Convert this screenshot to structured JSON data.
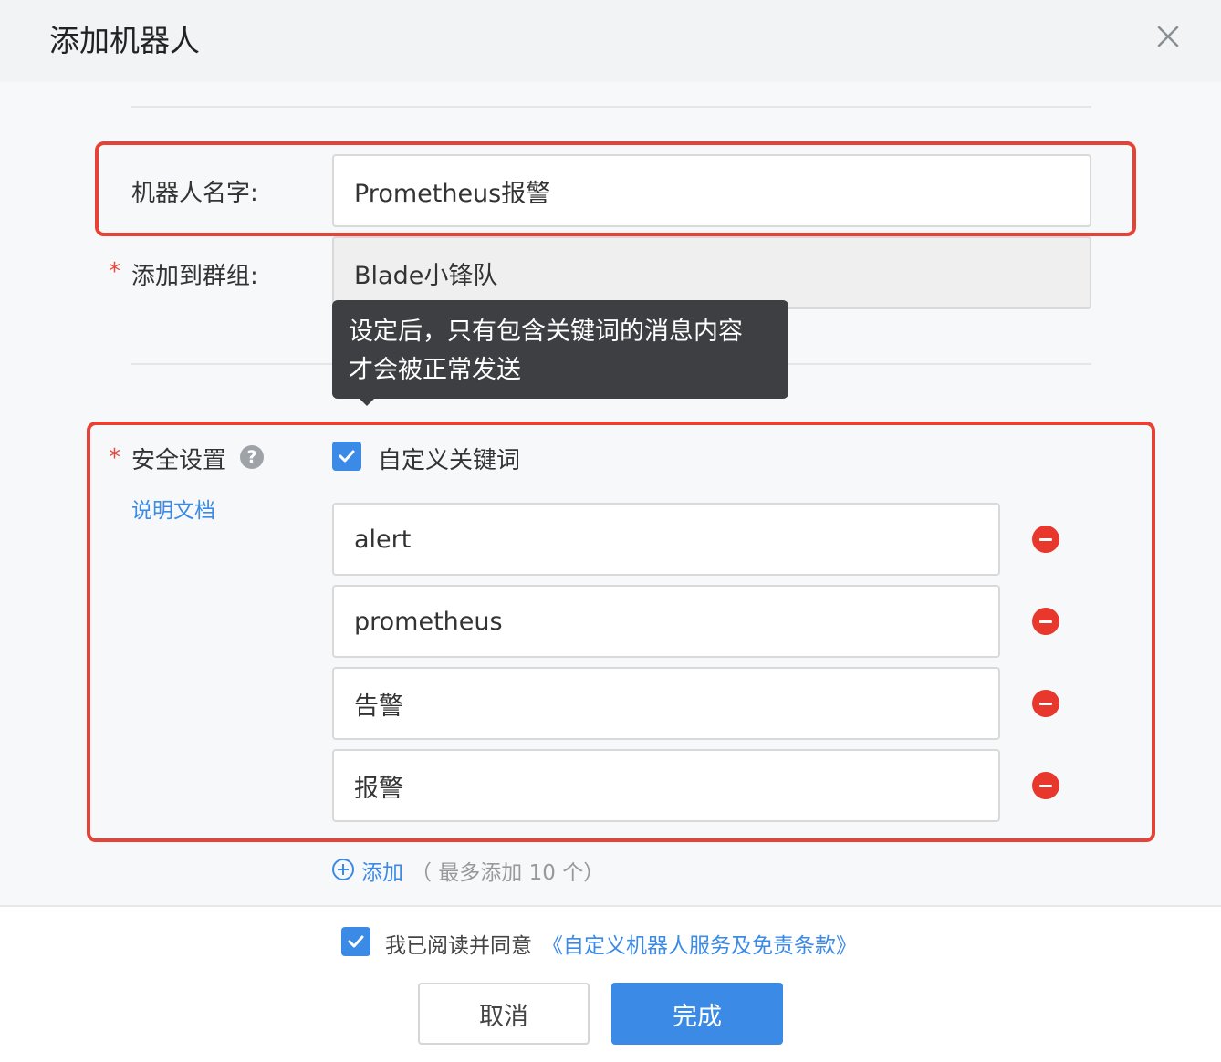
{
  "dialog": {
    "title": "添加机器人",
    "close_icon": "close-icon"
  },
  "form": {
    "robot_name": {
      "label": "机器人名字:",
      "value": "Prometheus报警"
    },
    "group": {
      "label": "添加到群组:",
      "required_mark": "*",
      "value": "Blade小锋队"
    },
    "tooltip": {
      "line1": "设定后，只有包含关键词的消息内容",
      "line2": "才会被正常发送"
    },
    "security": {
      "label": "安全设置",
      "required_mark": "*",
      "help_icon": "question-icon",
      "help_glyph": "?",
      "doc_link": "说明文档",
      "custom_keyword": {
        "label": "自定义关键词",
        "checked": true
      },
      "keywords": [
        "alert",
        "prometheus",
        "告警",
        "报警"
      ],
      "add": {
        "label": "添加",
        "hint": "（ 最多添加 10 个）"
      }
    }
  },
  "footer": {
    "agree_text": "我已阅读并同意",
    "agree_link": "《自定义机器人服务及免责条款》",
    "agree_checked": true,
    "cancel_label": "取消",
    "ok_label": "完成"
  },
  "colors": {
    "accent": "#3b8ae6",
    "danger": "#e64235",
    "tooltip_bg": "#3d3f43"
  }
}
